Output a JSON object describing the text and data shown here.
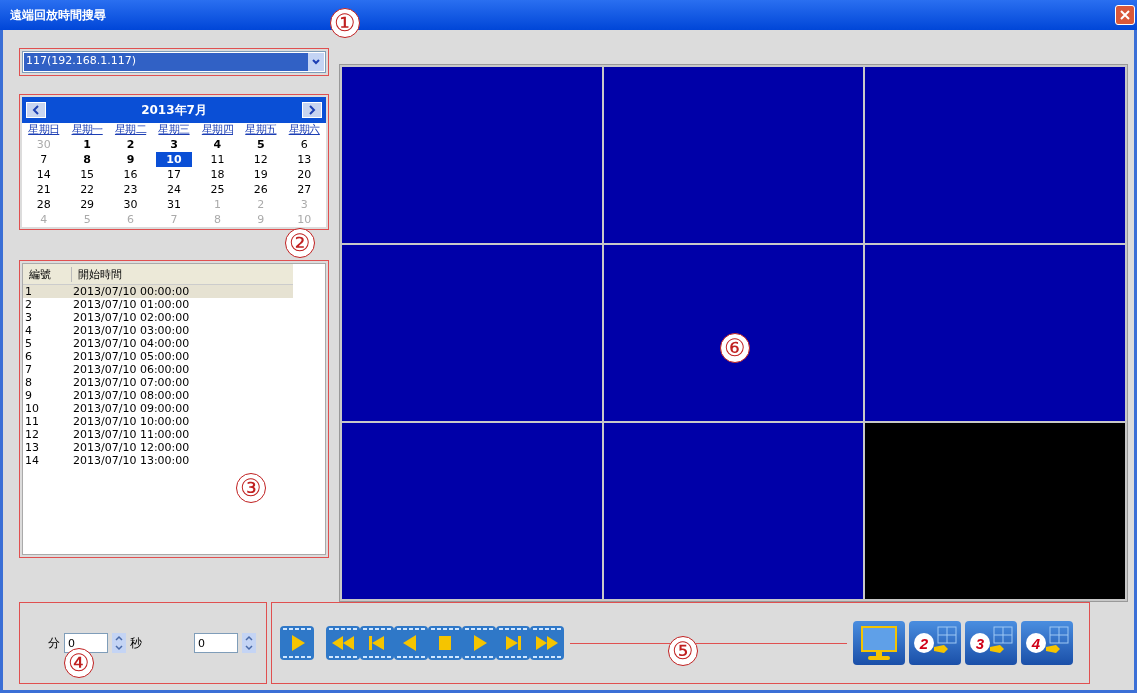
{
  "window": {
    "title": "遠端回放時間搜尋"
  },
  "device_select": {
    "value": "117(192.168.1.117)"
  },
  "calendar": {
    "month": "2013年7月",
    "weekdays": [
      "星期日",
      "星期一",
      "星期二",
      "星期三",
      "星期四",
      "星期五",
      "星期六"
    ],
    "weeks": [
      [
        {
          "d": "30",
          "other": true,
          "bold": false,
          "selected": false
        },
        {
          "d": "1",
          "other": false,
          "bold": true,
          "selected": false
        },
        {
          "d": "2",
          "other": false,
          "bold": true,
          "selected": false
        },
        {
          "d": "3",
          "other": false,
          "bold": true,
          "selected": false
        },
        {
          "d": "4",
          "other": false,
          "bold": true,
          "selected": false
        },
        {
          "d": "5",
          "other": false,
          "bold": true,
          "selected": false
        },
        {
          "d": "6",
          "other": false,
          "bold": false,
          "selected": false
        }
      ],
      [
        {
          "d": "7",
          "other": false,
          "bold": false,
          "selected": false
        },
        {
          "d": "8",
          "other": false,
          "bold": true,
          "selected": false
        },
        {
          "d": "9",
          "other": false,
          "bold": true,
          "selected": false
        },
        {
          "d": "10",
          "other": false,
          "bold": true,
          "selected": true
        },
        {
          "d": "11",
          "other": false,
          "bold": false,
          "selected": false
        },
        {
          "d": "12",
          "other": false,
          "bold": false,
          "selected": false
        },
        {
          "d": "13",
          "other": false,
          "bold": false,
          "selected": false
        }
      ],
      [
        {
          "d": "14",
          "other": false,
          "bold": false,
          "selected": false
        },
        {
          "d": "15",
          "other": false,
          "bold": false,
          "selected": false
        },
        {
          "d": "16",
          "other": false,
          "bold": false,
          "selected": false
        },
        {
          "d": "17",
          "other": false,
          "bold": false,
          "selected": false
        },
        {
          "d": "18",
          "other": false,
          "bold": false,
          "selected": false
        },
        {
          "d": "19",
          "other": false,
          "bold": false,
          "selected": false
        },
        {
          "d": "20",
          "other": false,
          "bold": false,
          "selected": false
        }
      ],
      [
        {
          "d": "21",
          "other": false,
          "bold": false,
          "selected": false
        },
        {
          "d": "22",
          "other": false,
          "bold": false,
          "selected": false
        },
        {
          "d": "23",
          "other": false,
          "bold": false,
          "selected": false
        },
        {
          "d": "24",
          "other": false,
          "bold": false,
          "selected": false
        },
        {
          "d": "25",
          "other": false,
          "bold": false,
          "selected": false
        },
        {
          "d": "26",
          "other": false,
          "bold": false,
          "selected": false
        },
        {
          "d": "27",
          "other": false,
          "bold": false,
          "selected": false
        }
      ],
      [
        {
          "d": "28",
          "other": false,
          "bold": false,
          "selected": false
        },
        {
          "d": "29",
          "other": false,
          "bold": false,
          "selected": false
        },
        {
          "d": "30",
          "other": false,
          "bold": false,
          "selected": false
        },
        {
          "d": "31",
          "other": false,
          "bold": false,
          "selected": false
        },
        {
          "d": "1",
          "other": true,
          "bold": false,
          "selected": false
        },
        {
          "d": "2",
          "other": true,
          "bold": false,
          "selected": false
        },
        {
          "d": "3",
          "other": true,
          "bold": false,
          "selected": false
        }
      ],
      [
        {
          "d": "4",
          "other": true,
          "bold": false,
          "selected": false
        },
        {
          "d": "5",
          "other": true,
          "bold": false,
          "selected": false
        },
        {
          "d": "6",
          "other": true,
          "bold": false,
          "selected": false
        },
        {
          "d": "7",
          "other": true,
          "bold": false,
          "selected": false
        },
        {
          "d": "8",
          "other": true,
          "bold": false,
          "selected": false
        },
        {
          "d": "9",
          "other": true,
          "bold": false,
          "selected": false
        },
        {
          "d": "10",
          "other": true,
          "bold": false,
          "selected": false
        }
      ]
    ]
  },
  "record_list": {
    "columns": [
      "編號",
      "開始時間"
    ],
    "rows": [
      {
        "no": "1",
        "time": "2013/07/10 00:00:00",
        "selected": true
      },
      {
        "no": "2",
        "time": "2013/07/10 01:00:00",
        "selected": false
      },
      {
        "no": "3",
        "time": "2013/07/10 02:00:00",
        "selected": false
      },
      {
        "no": "4",
        "time": "2013/07/10 03:00:00",
        "selected": false
      },
      {
        "no": "5",
        "time": "2013/07/10 04:00:00",
        "selected": false
      },
      {
        "no": "6",
        "time": "2013/07/10 05:00:00",
        "selected": false
      },
      {
        "no": "7",
        "time": "2013/07/10 06:00:00",
        "selected": false
      },
      {
        "no": "8",
        "time": "2013/07/10 07:00:00",
        "selected": false
      },
      {
        "no": "9",
        "time": "2013/07/10 08:00:00",
        "selected": false
      },
      {
        "no": "10",
        "time": "2013/07/10 09:00:00",
        "selected": false
      },
      {
        "no": "11",
        "time": "2013/07/10 10:00:00",
        "selected": false
      },
      {
        "no": "12",
        "time": "2013/07/10 11:00:00",
        "selected": false
      },
      {
        "no": "13",
        "time": "2013/07/10 12:00:00",
        "selected": false
      },
      {
        "no": "14",
        "time": "2013/07/10 13:00:00",
        "selected": false
      }
    ]
  },
  "time_offset": {
    "minutes_label": "分",
    "minutes": "0",
    "seconds_label": "秒",
    "seconds": "0"
  },
  "video_cells": [
    {
      "active": true
    },
    {
      "active": true
    },
    {
      "active": true
    },
    {
      "active": true
    },
    {
      "active": true
    },
    {
      "active": true
    },
    {
      "active": true
    },
    {
      "active": true
    },
    {
      "active": false
    }
  ],
  "play_button": {
    "kind": "play"
  },
  "transport_buttons": [
    {
      "kind": "rewind"
    },
    {
      "kind": "prev"
    },
    {
      "kind": "reverse"
    },
    {
      "kind": "stop"
    },
    {
      "kind": "play"
    },
    {
      "kind": "next"
    },
    {
      "kind": "forward"
    }
  ],
  "layout_buttons": [
    {
      "kind": "single"
    },
    {
      "kind": "grid",
      "label": "2"
    },
    {
      "kind": "grid",
      "label": "3"
    },
    {
      "kind": "grid",
      "label": "4"
    }
  ],
  "annotations": [
    "①",
    "②",
    "③",
    "④",
    "⑤",
    "⑥"
  ]
}
